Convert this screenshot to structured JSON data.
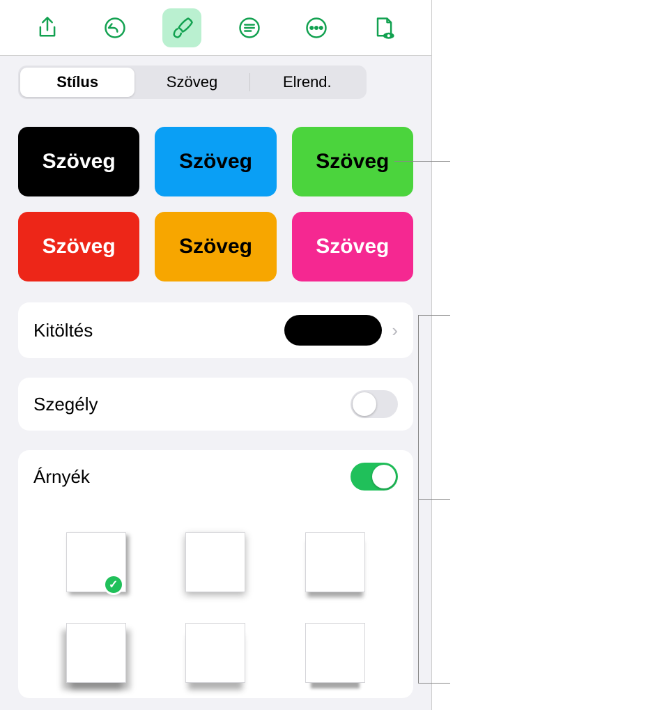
{
  "segments": {
    "style": "Stílus",
    "text": "Szöveg",
    "arrange": "Elrend."
  },
  "swatches": [
    {
      "label": "Szöveg",
      "bg": "#000000",
      "darkText": false
    },
    {
      "label": "Szöveg",
      "bg": "#0a9ff5",
      "darkText": true
    },
    {
      "label": "Szöveg",
      "bg": "#4bd43d",
      "darkText": true
    },
    {
      "label": "Szöveg",
      "bg": "#ed2618",
      "darkText": false
    },
    {
      "label": "Szöveg",
      "bg": "#f7a600",
      "darkText": true
    },
    {
      "label": "Szöveg",
      "bg": "#f52891",
      "darkText": false
    }
  ],
  "rows": {
    "fill": "Kitöltés",
    "border": "Szegély",
    "shadow": "Árnyék"
  },
  "fillColor": "#000000"
}
